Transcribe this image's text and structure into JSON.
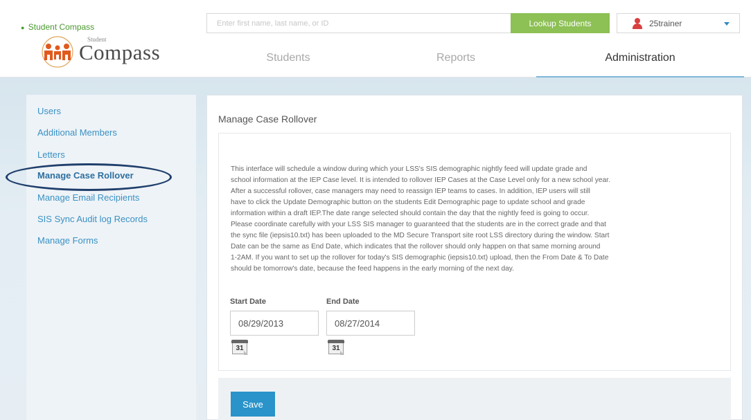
{
  "header": {
    "brand_link": "Student Compass",
    "logo_small_text": "Student",
    "logo_text": "Compass",
    "search": {
      "placeholder": "Enter first name, last name, or ID",
      "value": ""
    },
    "lookup_button": "Lookup Students",
    "user": {
      "name": "25trainer"
    }
  },
  "nav": {
    "tabs": [
      {
        "label": "Students",
        "active": false
      },
      {
        "label": "Reports",
        "active": false
      },
      {
        "label": "Administration",
        "active": true
      }
    ]
  },
  "sidebar": {
    "items": [
      {
        "label": "Users"
      },
      {
        "label": "Additional Members"
      },
      {
        "label": "Letters"
      },
      {
        "label": "Manage Case Rollover",
        "active": true
      },
      {
        "label": "Manage Email Recipients"
      },
      {
        "label": "SIS Sync Audit log Records"
      },
      {
        "label": "Manage Forms"
      }
    ]
  },
  "main": {
    "title": "Manage Case Rollover",
    "description_lines": [
      "This interface will schedule a window during which your LSS's SIS demographic nightly feed will update grade and",
      "school information at the IEP Case level. It is intended to rollover IEP Cases at the Case Level only for a new school year.",
      "After a successful rollover, case managers may need to reassign IEP teams to cases. In addition, IEP users will still",
      "have to click the Update Demographic button on the students Edit Demographic page to update school and grade",
      "information within a draft IEP.The date range selected should contain the day that the nightly feed is going to occur.",
      "Please coordinate carefully with your LSS SIS manager to guaranteed that the students are in the correct grade and that",
      "the sync file (iepsis10.txt) has been uploaded to the MD Secure Transport site root LSS directory during the window. Start",
      "Date can be the same as End Date, which indicates that the rollover should only happen on that same morning around",
      "1-2AM. If you want to set up the rollover for today's SIS demographic (iepsis10.txt) upload, then the From Date & To Date",
      "should be tomorrow's date, because the feed happens in the early morning of the next day."
    ],
    "start_date": {
      "label": "Start Date",
      "value": "08/29/2013"
    },
    "end_date": {
      "label": "End Date",
      "value": "08/27/2014"
    },
    "calendar_icon_text": "31",
    "save_button": "Save"
  },
  "colors": {
    "accent_green": "#8dc055",
    "link_blue": "#3a91c4",
    "button_blue": "#2a93c9",
    "highlight_ring": "#1f3f6c"
  }
}
